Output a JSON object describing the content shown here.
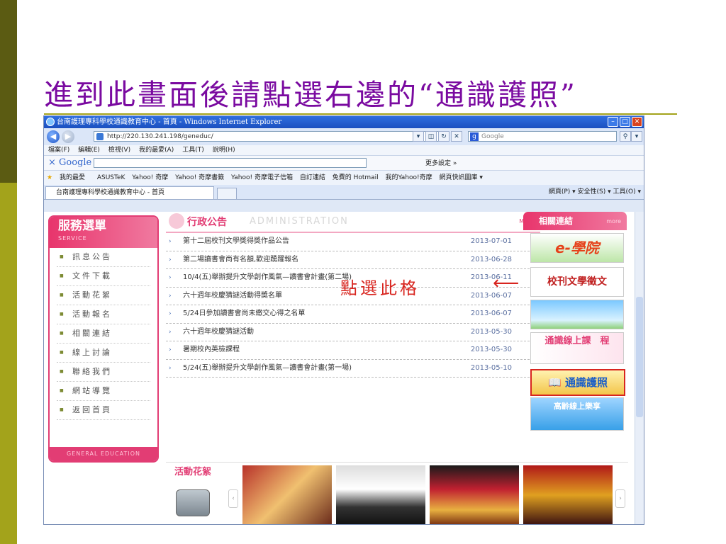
{
  "slide": {
    "title": "進到此畫面後請點選右邊的“通識護照”",
    "callout": "點選此格",
    "callout_arrow": "⟵"
  },
  "browser": {
    "window_title": "台南護理專科學校通識教育中心 - 首頁 - Windows Internet Explorer",
    "address": "http://220.130.241.198/geneduc/",
    "search_placeholder": "Google",
    "menu": [
      "檔案(F)",
      "編輯(E)",
      "檢視(V)",
      "我的最愛(A)",
      "工具(T)",
      "說明(H)"
    ],
    "google_bar": {
      "logo": "Google",
      "more_settings": "更多設定 »"
    },
    "favorites_label": "我的最愛",
    "favorites": [
      "ASUSTeK",
      "Yahoo! 奇摩",
      "Yahoo! 奇摩書籤",
      "Yahoo! 奇摩電子信箱",
      "自訂連結",
      "免費的 Hotmail",
      "我的Yahoo!奇摩",
      "網頁快訊圖庫 ▾"
    ],
    "tab_title": "台南護理專科學校通識教育中心 - 首頁",
    "command_bar": "網頁(P) ▾  安全性(S) ▾  工具(O) ▾"
  },
  "sidebar": {
    "title": "服務選單",
    "subtitle": "SERVICE",
    "items": [
      "訊息公告",
      "文件下載",
      "活動花絮",
      "活動報名",
      "相關連結",
      "線上討論",
      "聯絡我們",
      "網站導覽",
      "返回首頁"
    ],
    "footer": "GENERAL EDUCATION"
  },
  "news": {
    "title": "行政公告",
    "subtitle": "ADMINISTRATION",
    "more": "MORE",
    "items": [
      {
        "text": "第十二屆校刊文學獎得獎作品公告",
        "date": "2013-07-01"
      },
      {
        "text": "第二場讀書會尚有名額,歡迎踴躍報名",
        "date": "2013-06-28"
      },
      {
        "text": "10/4(五)舉辦提升文學創作風氣—讀書會計畫(第二場)",
        "date": "2013-06-11"
      },
      {
        "text": "六十週年校慶猜謎活動得獎名單",
        "date": "2013-06-07"
      },
      {
        "text": "5/24日參加讀書會尚未繳交心得之名單",
        "date": "2013-06-07"
      },
      {
        "text": "六十週年校慶猜謎活動",
        "date": "2013-05-30"
      },
      {
        "text": "暑期校內英檢課程",
        "date": "2013-05-30"
      },
      {
        "text": "5/24(五)舉辦提升文學創作風氣—讀書會計畫(第一場)",
        "date": "2013-05-10"
      }
    ]
  },
  "links": {
    "title": "相關連結",
    "more": "more",
    "banners": {
      "elearning": "e-學院",
      "journal": "校刊文學徵文",
      "online_course": "通識線上課　程",
      "passport": "通識護照",
      "senior": "高齡線上樂享"
    }
  },
  "gallery": {
    "title": "活動花絮"
  },
  "colors": {
    "accent": "#e23d74",
    "title": "#7a0aa0",
    "callout": "#d8251f"
  }
}
